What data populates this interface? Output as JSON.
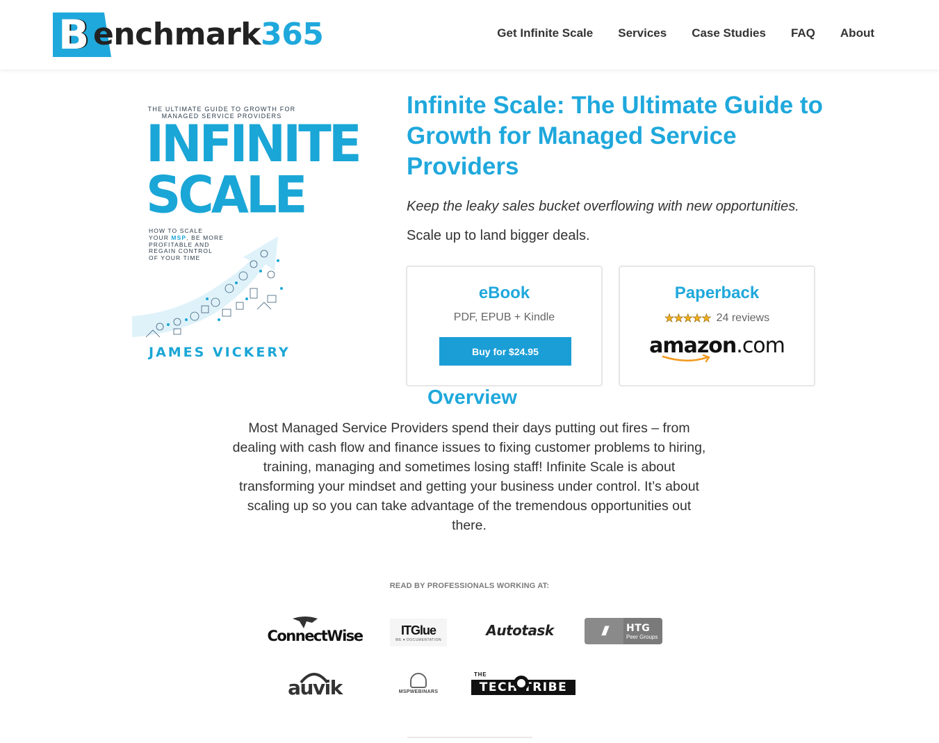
{
  "brand": {
    "logo_letter": "B",
    "logo_word": "enchmark",
    "logo_number": "365",
    "accent": "#1fa8dc"
  },
  "nav": {
    "items": [
      {
        "label": "Get Infinite Scale"
      },
      {
        "label": "Services"
      },
      {
        "label": "Case Studies"
      },
      {
        "label": "FAQ"
      },
      {
        "label": "About"
      }
    ]
  },
  "cover": {
    "kicker_line1": "THE ULTIMATE GUIDE TO GROWTH FOR",
    "kicker_line2": "MANAGED SERVICE PROVIDERS",
    "title_line1": "INFINITE",
    "title_line2": "SCALE",
    "sub_1": "HOW TO SCALE",
    "sub_2a": "YOUR ",
    "sub_2b": "MSP",
    "sub_2c": ", BE MORE",
    "sub_3": "PROFITABLE AND",
    "sub_4": "REGAIN CONTROL",
    "sub_5": "OF YOUR TIME",
    "author": "JAMES VICKERY"
  },
  "product": {
    "title": "Infinite Scale: The Ultimate Guide to Growth for Managed Service Providers",
    "tagline": "Keep the leaky sales bucket overflowing with new opportunities.",
    "subline": "Scale up to land bigger deals."
  },
  "ebook": {
    "heading": "eBook",
    "formats": "PDF, EPUB + Kindle",
    "buy_label": "Buy for $24.95"
  },
  "paperback": {
    "heading": "Paperback",
    "stars": "★★★★★",
    "rating": 5,
    "reviews": "24 reviews",
    "amazon_word": "amazon",
    "amazon_tld": ".com"
  },
  "overview": {
    "heading": "Overview",
    "body": "Most Managed Service Providers spend their days putting out fires – from dealing with cash flow and finance issues to fixing customer problems to hiring, training, managing and sometimes losing staff! Infinite Scale is about transforming your mindset and getting your business under control. It’s about scaling up so you can take advantage of the tremendous opportunities out there."
  },
  "read_by": "READ BY PROFESSIONALS WORKING AT:",
  "logos": {
    "connectwise": "ConnectWise",
    "itglue": "ITGlue",
    "itglue_sub": "WE ♥ DOCUMENTATION",
    "autotask": "Autotask",
    "htg": "HTG",
    "htg_sub": "Peer Groups",
    "auvik": "auvik",
    "mspwebinars": "MSPWEBINARS",
    "techtribe_the": "THE",
    "techtribe": "TECH   TRIBE"
  }
}
